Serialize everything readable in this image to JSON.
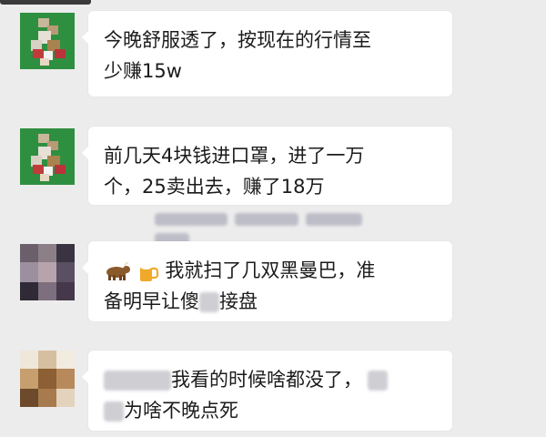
{
  "messages": [
    {
      "text_line1": "今晚舒服透了，按现在的行情至",
      "text_line2": "少赚15w"
    },
    {
      "text_line1": "前几天4块钱进口罩，进了一万",
      "text_line2": "个，25卖出去，赚了18万"
    },
    {
      "emojis": [
        "ox-emoji",
        "beer-emoji"
      ],
      "text_line1": "我就扫了几双黑曼巴，准",
      "text_line2_a": "备明早让傻",
      "text_line2_b": "接盘"
    },
    {
      "text_line1": "我看的时候啥都没了，",
      "text_line2": "为啥不晚点死"
    }
  ],
  "colors": {
    "background": "#ececec",
    "bubble": "#ffffff",
    "text": "#1b1b1b",
    "avatar_green": "#2e8b3e",
    "redaction": "#c9c9cf"
  }
}
